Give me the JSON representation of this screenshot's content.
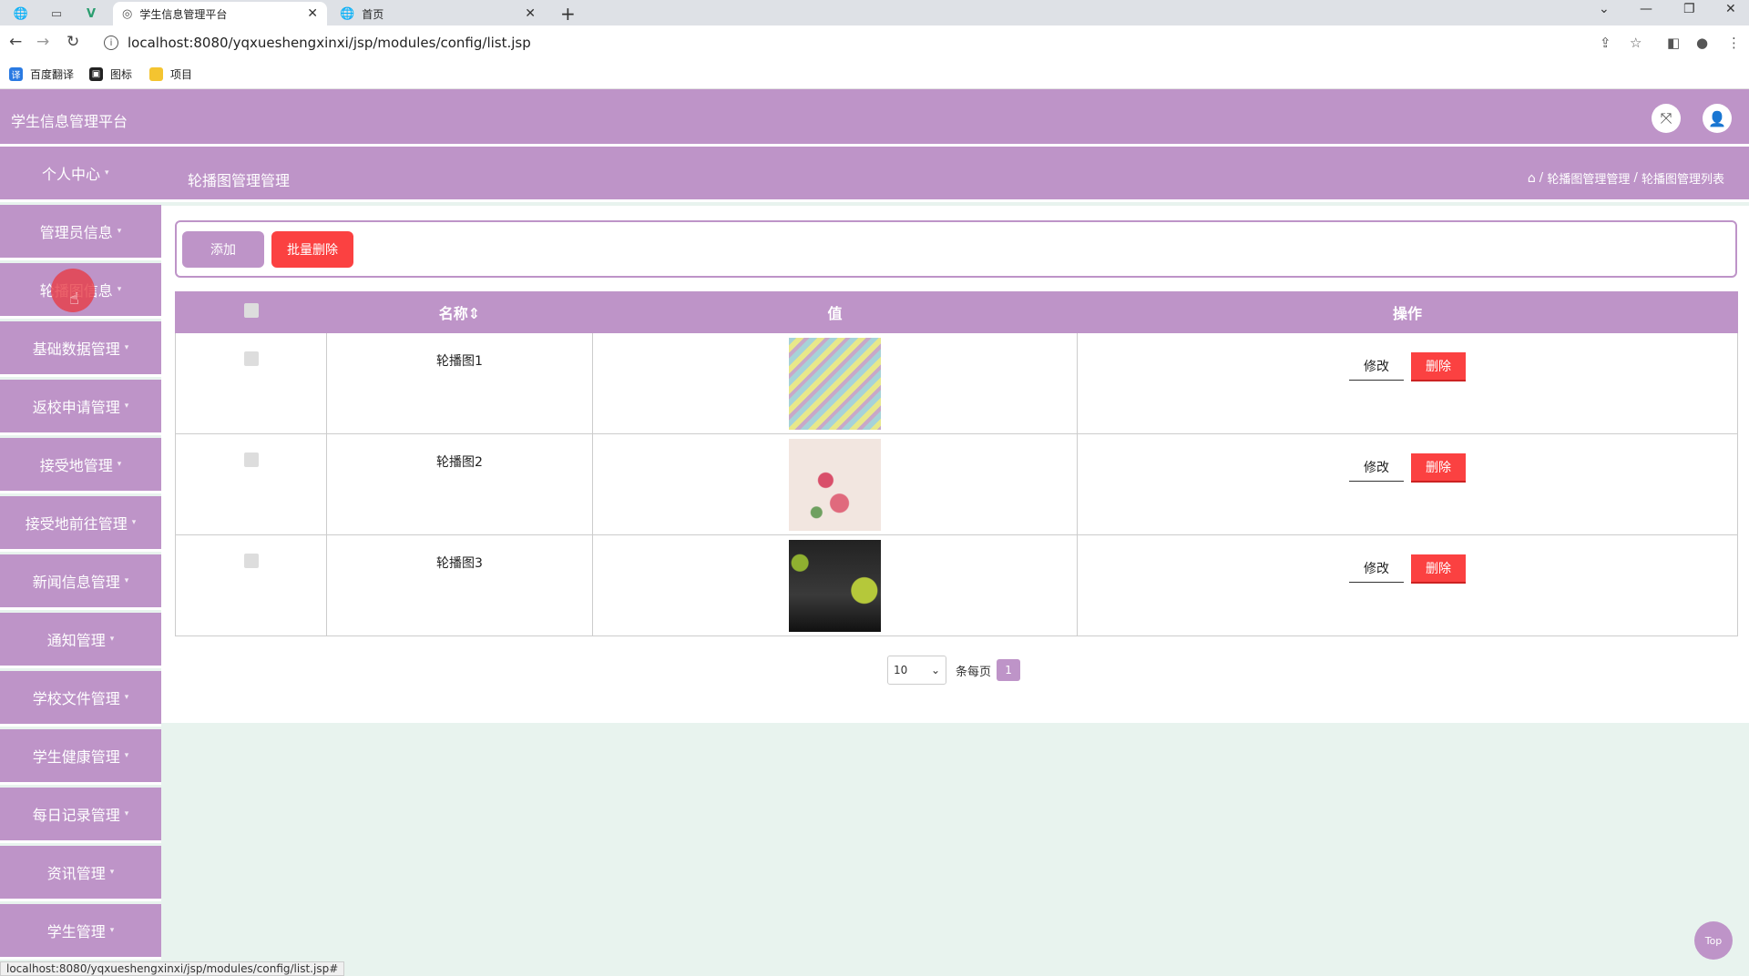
{
  "browser": {
    "tabs": [
      {
        "label": "学生信息管理平台",
        "active": true
      },
      {
        "label": "首页",
        "active": false
      }
    ],
    "url": "localhost:8080/yqxueshengxinxi/jsp/modules/config/list.jsp",
    "bookmarks": [
      "百度翻译",
      "图标",
      "项目"
    ],
    "status_url": "localhost:8080/yqxueshengxinxi/jsp/modules/config/list.jsp#"
  },
  "header": {
    "title": "学生信息管理平台"
  },
  "sidebar": {
    "items": [
      {
        "label": "个人中心"
      },
      {
        "label": "管理员信息"
      },
      {
        "label": "轮播图信息"
      },
      {
        "label": "基础数据管理"
      },
      {
        "label": "返校申请管理"
      },
      {
        "label": "接受地管理"
      },
      {
        "label": "接受地前往管理"
      },
      {
        "label": "新闻信息管理"
      },
      {
        "label": "通知管理"
      },
      {
        "label": "学校文件管理"
      },
      {
        "label": "学生健康管理"
      },
      {
        "label": "每日记录管理"
      },
      {
        "label": "资讯管理"
      },
      {
        "label": "学生管理"
      }
    ]
  },
  "page": {
    "title": "轮播图管理管理",
    "breadcrumb": [
      "轮播图管理管理",
      "轮播图管理列表"
    ]
  },
  "toolbar": {
    "add_label": "添加",
    "batch_delete_label": "批量删除"
  },
  "table": {
    "columns": [
      "",
      "名称",
      "值",
      "操作"
    ],
    "sort_indicator": "⇕",
    "rows": [
      {
        "name": "轮播图1"
      },
      {
        "name": "轮播图2"
      },
      {
        "name": "轮播图3"
      }
    ],
    "edit_label": "修改",
    "delete_label": "删除"
  },
  "pager": {
    "page_size": "10",
    "per_page_label": "条每页",
    "current_page": "1"
  },
  "top_button": "Top",
  "colors": {
    "primary": "#be94c8",
    "danger": "#fb4141",
    "background": "#e8f3ee"
  }
}
